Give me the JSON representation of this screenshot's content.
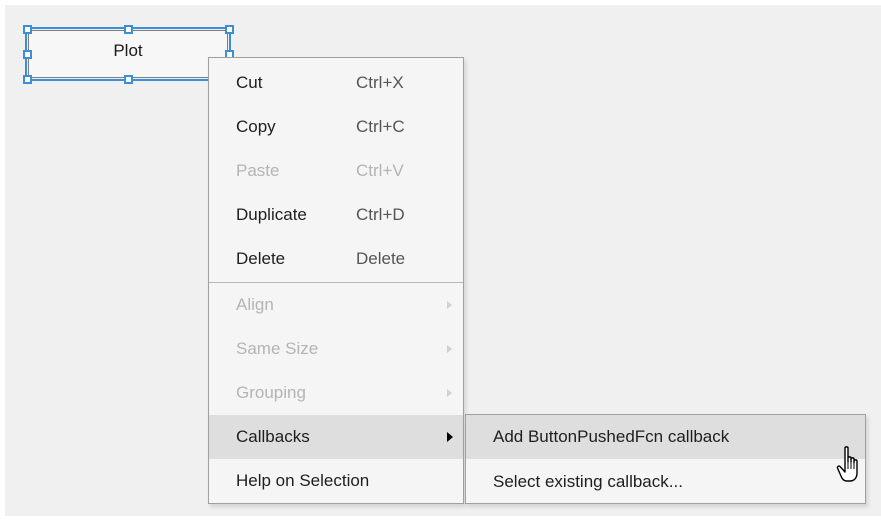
{
  "plot_button": {
    "label": "Plot"
  },
  "context_menu": {
    "items": [
      {
        "label": "Cut",
        "shortcut": "Ctrl+X",
        "enabled": true
      },
      {
        "label": "Copy",
        "shortcut": "Ctrl+C",
        "enabled": true
      },
      {
        "label": "Paste",
        "shortcut": "Ctrl+V",
        "enabled": false
      },
      {
        "label": "Duplicate",
        "shortcut": "Ctrl+D",
        "enabled": true
      },
      {
        "label": "Delete",
        "shortcut": "Delete",
        "enabled": true
      },
      {
        "label": "Align",
        "enabled": false,
        "submenu": true
      },
      {
        "label": "Same Size",
        "enabled": false,
        "submenu": true
      },
      {
        "label": "Grouping",
        "enabled": false,
        "submenu": true
      },
      {
        "label": "Callbacks",
        "enabled": true,
        "submenu": true,
        "highlighted": true
      },
      {
        "label": "Help on Selection",
        "enabled": true
      }
    ]
  },
  "callbacks_submenu": {
    "items": [
      {
        "label": "Add ButtonPushedFcn callback",
        "highlighted": true
      },
      {
        "label": "Select existing callback..."
      }
    ]
  },
  "colors": {
    "selection": "#3c8ed6",
    "menu_background": "#f5f5f5",
    "highlight": "#dedede",
    "disabled_text": "#b4b4b4"
  },
  "cursor": "hand-pointer-icon"
}
